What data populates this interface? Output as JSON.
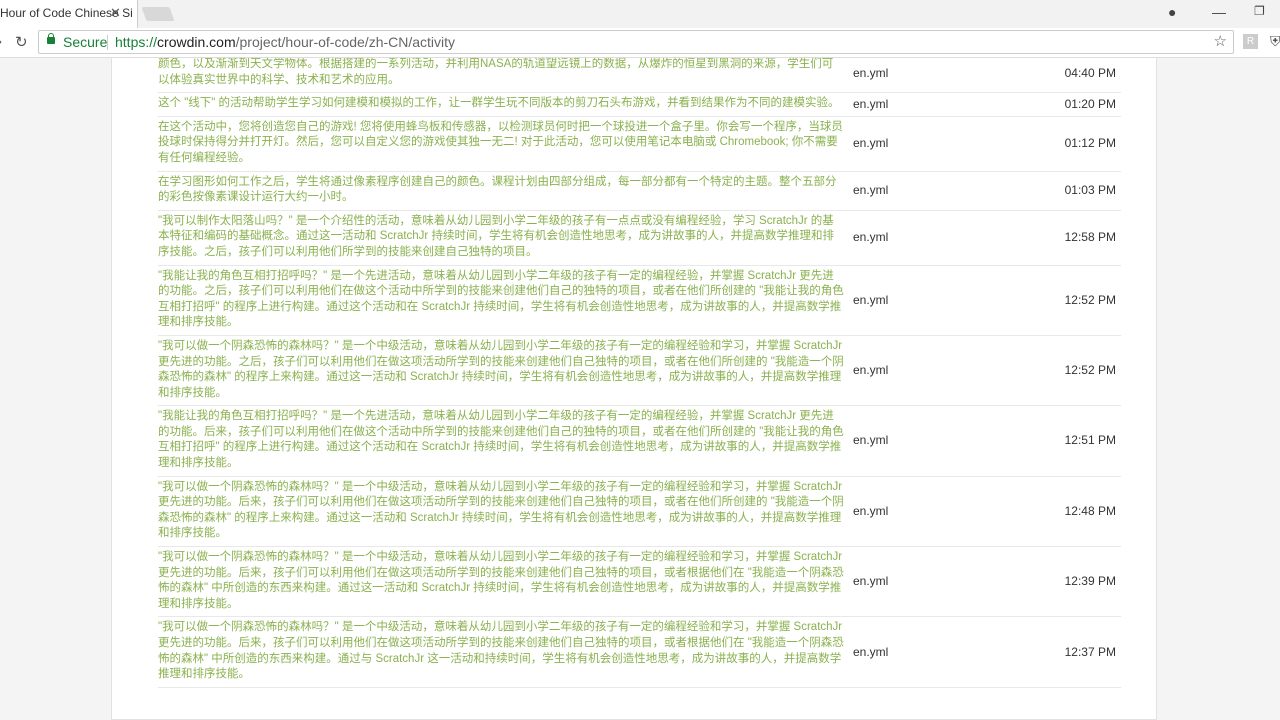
{
  "browser": {
    "tab_title": "Hour of Code Chinese Si",
    "secure_label": "Secure",
    "url_scheme": "https://",
    "url_domain": "crowdin.com",
    "url_path": "/project/hour-of-code/zh-CN/activity",
    "extension_label": "R"
  },
  "rows": [
    {
      "text": "颜色，以及渐渐到天文学物体。根据搭建的一系列活动，并利用NASA的轨道望远镜上的数据，从爆炸的恒星到黑洞的来源，学生们可以体验真实世界中的科学、技术和艺术的应用。",
      "file": "en.yml",
      "time": "04:40 PM"
    },
    {
      "text": "这个 \"线下\" 的活动帮助学生学习如何建模和模拟的工作，让一群学生玩不同版本的剪刀石头布游戏，并看到结果作为不同的建模实验。",
      "file": "en.yml",
      "time": "01:20 PM"
    },
    {
      "text": "在这个活动中，您将创造您自己的游戏! 您将使用蜂鸟板和传感器，以检测球员何时把一个球投进一个盒子里。你会写一个程序，当球员投球时保持得分并打开灯。然后，您可以自定义您的游戏使其独一无二! 对于此活动，您可以使用笔记本电脑或 Chromebook; 你不需要有任何编程经验。",
      "file": "en.yml",
      "time": "01:12 PM"
    },
    {
      "text": "在学习图形如何工作之后，学生将通过像素程序创建自己的颜色。课程计划由四部分组成，每一部分都有一个特定的主题。整个五部分的彩色按像素课设计运行大约一小时。",
      "file": "en.yml",
      "time": "01:03 PM"
    },
    {
      "text": "\"我可以制作太阳落山吗？\" 是一个介绍性的活动，意味着从幼儿园到小学二年级的孩子有一点点或没有编程经验，学习 ScratchJr 的基本特征和编码的基础概念。通过这一活动和 ScratchJr 持续时间，学生将有机会创造性地思考，成为讲故事的人，并提高数学推理和排序技能。之后，孩子们可以利用他们所学到的技能来创建自己独特的项目。",
      "file": "en.yml",
      "time": "12:58 PM"
    },
    {
      "text": "\"我能让我的角色互相打招呼吗？\" 是一个先进活动，意味着从幼儿园到小学二年级的孩子有一定的编程经验，并掌握 ScratchJr 更先进的功能。之后，孩子们可以利用他们在做这个活动中所学到的技能来创建他们自己的独特的项目，或者在他们所创建的 \"我能让我的角色互相打招呼\" 的程序上进行构建。通过这个活动和在 ScratchJr 持续时间，学生将有机会创造性地思考，成为讲故事的人，并提高数学推理和排序技能。",
      "file": "en.yml",
      "time": "12:52 PM"
    },
    {
      "text": "\"我可以做一个阴森恐怖的森林吗？\" 是一个中级活动，意味着从幼儿园到小学二年级的孩子有一定的编程经验和学习，并掌握 ScratchJr 更先进的功能。之后，孩子们可以利用他们在做这项活动所学到的技能来创建他们自己独特的项目，或者在他们所创建的 \"我能造一个阴森恐怖的森林\" 的程序上来构建。通过这一活动和 ScratchJr 持续时间，学生将有机会创造性地思考，成为讲故事的人，并提高数学推理和排序技能。",
      "file": "en.yml",
      "time": "12:52 PM"
    },
    {
      "text": "\"我能让我的角色互相打招呼吗？\" 是一个先进活动，意味着从幼儿园到小学二年级的孩子有一定的编程经验，并掌握 ScratchJr 更先进的功能。后来，孩子们可以利用他们在做这个活动中所学到的技能来创建他们自己的独特的项目，或者在他们所创建的 \"我能让我的角色互相打招呼\" 的程序上进行构建。通过这个活动和在 ScratchJr 持续时间，学生将有机会创造性地思考，成为讲故事的人，并提高数学推理和排序技能。",
      "file": "en.yml",
      "time": "12:51 PM"
    },
    {
      "text": "\"我可以做一个阴森恐怖的森林吗？\" 是一个中级活动，意味着从幼儿园到小学二年级的孩子有一定的编程经验和学习，并掌握 ScratchJr 更先进的功能。后来，孩子们可以利用他们在做这项活动所学到的技能来创建他们自己独特的项目，或者在他们所创建的 \"我能造一个阴森恐怖的森林\" 的程序上来构建。通过这一活动和 ScratchJr 持续时间，学生将有机会创造性地思考，成为讲故事的人，并提高数学推理和排序技能。",
      "file": "en.yml",
      "time": "12:48 PM"
    },
    {
      "text": "\"我可以做一个阴森恐怖的森林吗？\" 是一个中级活动，意味着从幼儿园到小学二年级的孩子有一定的编程经验和学习，并掌握 ScratchJr 更先进的功能。后来，孩子们可以利用他们在做这项活动所学到的技能来创建他们自己独特的项目，或者根据他们在 \"我能造一个阴森恐怖的森林\" 中所创造的东西来构建。通过这一活动和 ScratchJr 持续时间，学生将有机会创造性地思考，成为讲故事的人，并提高数学推理和排序技能。",
      "file": "en.yml",
      "time": "12:39 PM"
    },
    {
      "text": "\"我可以做一个阴森恐怖的森林吗？\" 是一个中级活动，意味着从幼儿园到小学二年级的孩子有一定的编程经验和学习，并掌握 ScratchJr 更先进的功能。后来，孩子们可以利用他们在做这项活动所学到的技能来创建他们自己独特的项目，或者根据他们在 \"我能造一个阴森恐怖的森林\" 中所创造的东西来构建。通过与 ScratchJr 这一活动和持续时间，学生将有机会创造性地思考，成为讲故事的人，并提高数学推理和排序技能。",
      "file": "en.yml",
      "time": "12:37 PM"
    }
  ]
}
